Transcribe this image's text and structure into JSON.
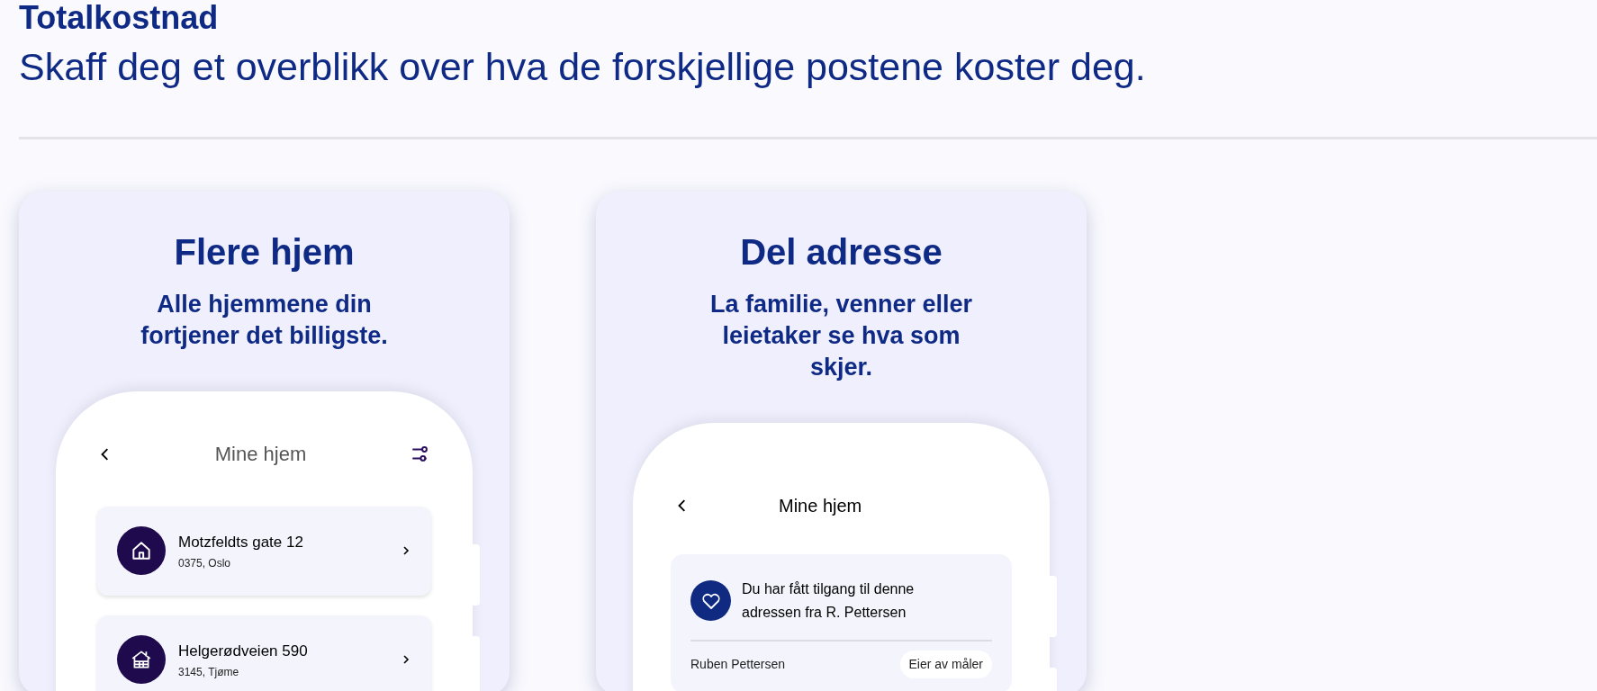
{
  "header": {
    "title": "Totalkostnad",
    "subtitle": "Skaff deg et overblikk over hva de forskjellige postene koster deg."
  },
  "cards": [
    {
      "kind": "homes",
      "title": "Flere hjem",
      "subtitle": "Alle hjemmene din fortjener det billigste.",
      "screen": {
        "title": "Mine hjem",
        "items": [
          {
            "kind": "house",
            "address": "Motzfeldts gate 12",
            "postcode": "0375, Oslo"
          },
          {
            "kind": "cabin",
            "address": "Helgerødveien 590",
            "postcode": "3145, Tjøme"
          }
        ]
      }
    },
    {
      "kind": "share",
      "title": "Del adresse",
      "subtitle": "La familie, venner eller leietaker se hva som skjer.",
      "screen": {
        "title": "Mine hjem",
        "notice": "Du har fått tilgang til denne adressen fra R. Pettersen",
        "owner": "Ruben Pettersen",
        "role": "Eier av måler"
      }
    }
  ]
}
